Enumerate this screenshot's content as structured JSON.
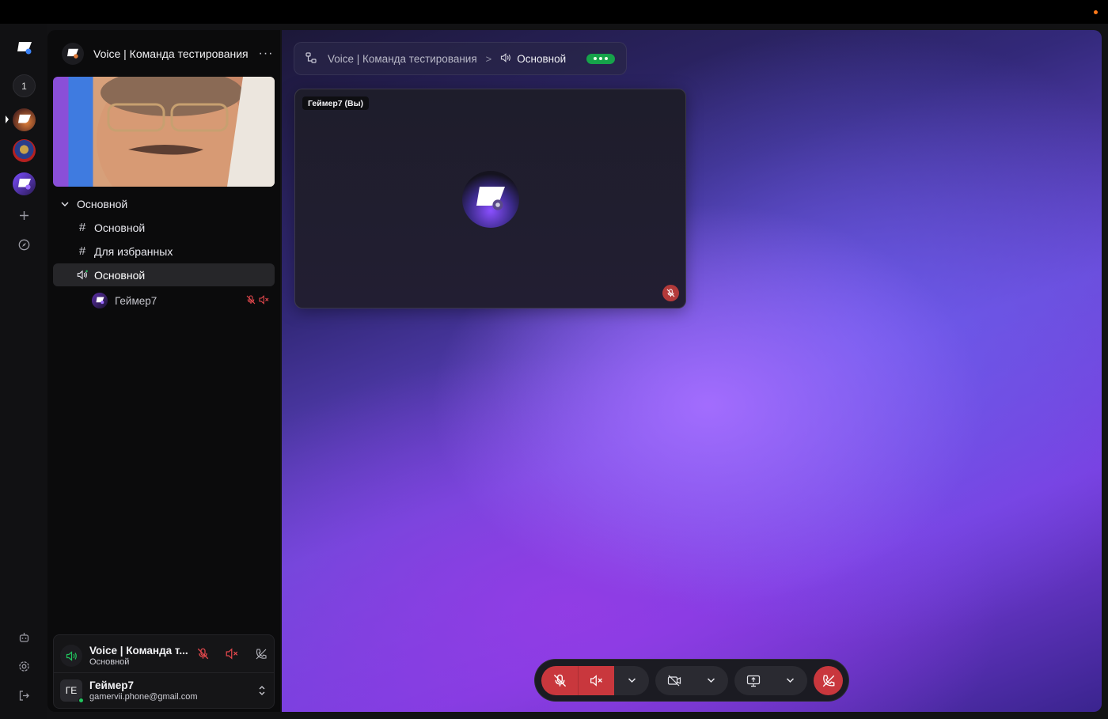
{
  "window": {
    "status_dot_color": "#ff7a1a"
  },
  "rail": {
    "unread_count": "1",
    "icons": [
      "app-logo-icon",
      "server-avatar-1",
      "server-avatar-2",
      "server-avatar-3",
      "plus-icon",
      "compass-icon",
      "robot-icon",
      "gear-icon",
      "logout-icon"
    ]
  },
  "server": {
    "title": "Voice | Команда тестирования",
    "more_label": "···",
    "category": "Основной",
    "channels": [
      {
        "type": "text",
        "glyph": "#",
        "label": "Основной"
      },
      {
        "type": "text",
        "glyph": "#",
        "label": "Для избранных"
      },
      {
        "type": "voice",
        "label": "Основной",
        "active": true
      }
    ],
    "voice_members": [
      {
        "name": "Геймер7",
        "mic_muted": true,
        "sound_muted": true
      }
    ]
  },
  "voice_panel": {
    "title": "Voice | Команда т...",
    "channel": "Основной"
  },
  "user_panel": {
    "initials": "ГЕ",
    "name": "Геймер7",
    "email": "gamervii.phone@gmail.com",
    "online_color": "#22c55e"
  },
  "breadcrumb": {
    "server": "Voice | Команда тестирования",
    "separator": ">",
    "channel": "Основной",
    "status_color": "#16a34a"
  },
  "tile": {
    "name_tag": "Геймер7 (Вы)"
  },
  "controls": {
    "accent_red": "#c9373d",
    "buttons": [
      "mic-off-icon",
      "speaker-off-icon",
      "chevron-down-icon",
      "camera-off-icon",
      "chevron-down-icon",
      "screen-share-icon",
      "chevron-down-icon",
      "hang-up-icon"
    ]
  }
}
